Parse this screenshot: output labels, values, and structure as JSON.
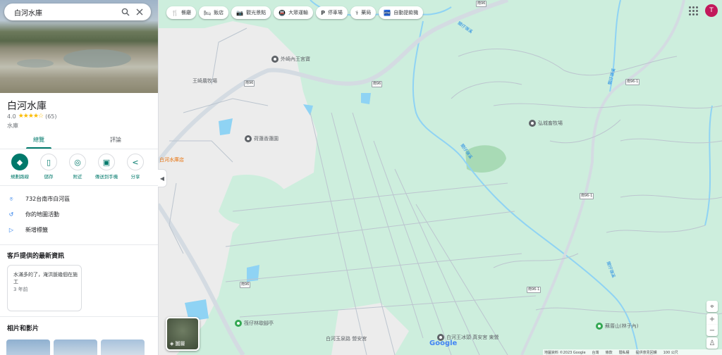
{
  "search": {
    "value": "白河水庫"
  },
  "place": {
    "title": "白河水庫",
    "rating": "4.0",
    "stars": "★★★★☆",
    "review_count": "(65)",
    "type": "水庫"
  },
  "tabs": [
    {
      "label": "總覽"
    },
    {
      "label": "評論"
    }
  ],
  "actions": [
    {
      "label": "規劃路線"
    },
    {
      "label": "儲存"
    },
    {
      "label": "附近"
    },
    {
      "label": "傳送到手機"
    },
    {
      "label": "分享"
    }
  ],
  "info": {
    "address": "732台南市白河區",
    "activity": "你的地圖活動",
    "label": "新增標籤"
  },
  "updates": {
    "heading": "客戶提供的最新資訊",
    "post_text": "水滿多的了，淹洪脈幾個在施工",
    "post_time": "3 年前"
  },
  "photos_heading": "相片和影片",
  "chips": [
    {
      "icon": "🍴",
      "label": "餐廳"
    },
    {
      "icon": "🛏",
      "label": "飯店"
    },
    {
      "icon": "📷",
      "label": "觀光景點"
    },
    {
      "icon": "🚇",
      "label": "大眾運輸"
    },
    {
      "icon": "P",
      "label": "停車場"
    },
    {
      "icon": "⚕",
      "label": "藥局"
    },
    {
      "icon": "🏧",
      "label": "自動提款機"
    }
  ],
  "account": {
    "initial": "T"
  },
  "layers": {
    "label": "圖層"
  },
  "map_labels": {
    "poi_temple": "外崎內王宮寶",
    "poi_ranch1": "王崎農牧場",
    "poi_garden": "荷蓮香蓮園",
    "poi_ranch2": "弘城畜牧場",
    "poi_orange": "白河水庫店",
    "poi_pavilion": "筏仔林歇腳亭",
    "poi_hall": "白河王冰頭 真安宮 東營",
    "poi_mountain": "蘇厝山(林子內)",
    "poi_church": "白河玉泉路 營安宮",
    "road_1": "南96",
    "road_2": "南96",
    "road_3": "南96-1",
    "road_4": "南96-1",
    "road_5": "南96-1",
    "road_6": "南96",
    "road_7": "南96",
    "river_1": "關仔嶺溪",
    "river_2": "關仔嶺溪",
    "river_3": "關仔嶺溪",
    "river_4": "關仔嶺溪"
  },
  "footer": {
    "logo": "Google",
    "attribution": [
      "地圖資料 ©2023 Google",
      "台灣",
      "條款",
      "隱私權",
      "提供意見回饋",
      "100 公尺"
    ]
  },
  "colors": {
    "map_green": "#cdeedd",
    "road": "#c7d0d8",
    "water": "#8fd3f4",
    "accent": "#00796b",
    "avatar": "#c2185b"
  }
}
